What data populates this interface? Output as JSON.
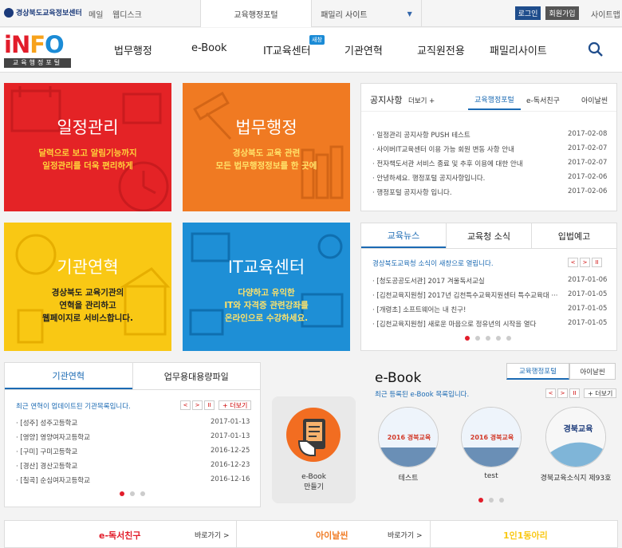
{
  "topbar": {
    "org": "경상북도교육정보센터",
    "links": [
      "메일",
      "웹디스크"
    ],
    "tabs": [
      "교육행정포털",
      "패밀리 사이트"
    ],
    "login": "로그인",
    "join": "회원가입",
    "sitemap": "사이트맵"
  },
  "logo": {
    "sub": "교육행정포털"
  },
  "nav": {
    "items": [
      "법무행정",
      "e-Book",
      "IT교육센터",
      "기관연혁",
      "교직원전용",
      "패밀리사이트"
    ],
    "new_badge": "새창"
  },
  "tiles": [
    {
      "title": "일정관리",
      "desc1": "달력으로 보고 알림기능까지",
      "desc2": "일정관리를 더욱 편리하게",
      "color": "#e42326"
    },
    {
      "title": "법무행정",
      "desc1": "경상북도 교육 관련",
      "desc2": "모든 법무행정정보를 한 곳에",
      "color": "#f07a22"
    },
    {
      "title": "기관연혁",
      "desc1": "경상북도 교육기관의",
      "desc2": "연혁을 관리하고",
      "desc3": "웹페이지로 서비스합니다.",
      "color": "#f9c814"
    },
    {
      "title": "IT교육센터",
      "desc1": "다양하고 유익한",
      "desc2": "IT와 자격증 관련강좌를",
      "desc3": "온라인으로 수강하세요.",
      "color": "#1e8fd6"
    }
  ],
  "notice": {
    "title": "공지사항",
    "more": "더보기 +",
    "tabs": [
      "교육행정포털",
      "e-독서친구",
      "아이날씬"
    ],
    "items": [
      {
        "text": "일정관리 공지사항 PUSH 테스트",
        "date": "2017-02-08"
      },
      {
        "text": "사이버IT교육센터 이용 가능 회원 변동 사항 안내",
        "date": "2017-02-07"
      },
      {
        "text": "전자책도서관 서비스 종료 및 추후 이용에 대한 안내",
        "date": "2017-02-07"
      },
      {
        "text": "안녕하세요. 행정포털 공지사항입니다.",
        "date": "2017-02-06"
      },
      {
        "text": "행정포털 공지사항 입니다.",
        "date": "2017-02-06"
      }
    ]
  },
  "news": {
    "tabs": [
      "교육뉴스",
      "교육청 소식",
      "입법예고"
    ],
    "headline": "경상북도교육청 소식이 새창으로 열립니다.",
    "items": [
      {
        "text": "[청도공공도서관] 2017 겨울독서교실",
        "date": "2017-01-06"
      },
      {
        "text": "[김천교육지원청] 2017년 김천특수교육지원센터 특수교육대 ···",
        "date": "2017-01-05"
      },
      {
        "text": "[개령초] 소프트웨어는 내 친구!",
        "date": "2017-01-05"
      },
      {
        "text": "[김천교육지원청] 새로운 마음으로 정유년의 시작을 열다",
        "date": "2017-01-05"
      }
    ]
  },
  "history": {
    "tabs": [
      "기관연혁",
      "업무용대용량파일"
    ],
    "headline": "최근 연혁이 업데이트된 기관목록입니다.",
    "more": "+ 더보기",
    "items": [
      {
        "text": "[성주] 성주고등학교",
        "date": "2017-01-13"
      },
      {
        "text": "[영양] 영양여자고등학교",
        "date": "2017-01-13"
      },
      {
        "text": "[구미] 구미고등학교",
        "date": "2016-12-25"
      },
      {
        "text": "[경산] 경산고등학교",
        "date": "2016-12-23"
      },
      {
        "text": "[칠곡] 순심여자고등학교",
        "date": "2016-12-16"
      }
    ]
  },
  "ebook_make": {
    "line1": "e-Book",
    "line2": "만들기"
  },
  "ebook": {
    "title": "e-Book",
    "tabs": [
      "교육행정포털",
      "아이날씬"
    ],
    "headline": "최근 등록된 e-Book 목록입니다.",
    "more": "+ 더보기",
    "items": [
      {
        "label": "테스트",
        "cover": "2016 경북교육"
      },
      {
        "label": "test",
        "cover": "2016 경북교육"
      },
      {
        "label": "경북교육소식지 제93호",
        "cover": "경북교육"
      }
    ]
  },
  "bottom": {
    "items": [
      {
        "label": "e-독서친구",
        "go": "바로가기 >"
      },
      {
        "label": "아이날씬",
        "go": "바로가기 >"
      },
      {
        "label": "1인1동아리",
        "go": "바로가기 >"
      }
    ]
  }
}
